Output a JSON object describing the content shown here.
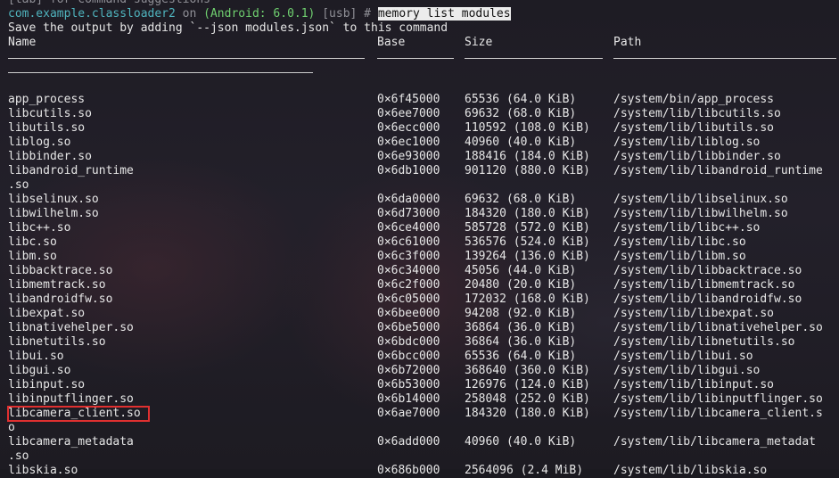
{
  "terminal": {
    "hint_line": "[tab] for command suggestions",
    "prompt": {
      "app": "com.example.classloader2",
      "on": " on ",
      "device": "(Android: 6.0.1)",
      "transport": " [usb] # ",
      "command": "memory list modules"
    },
    "info_line": "Save the output by adding `--json modules.json` to this command"
  },
  "table": {
    "headers": {
      "name": "Name",
      "base": "Base",
      "size": "Size",
      "path": "Path"
    },
    "rows": [
      {
        "name": "app_process",
        "base": "0x6f45000",
        "size": "65536 (64.0 KiB)",
        "path": "/system/bin/app_process"
      },
      {
        "name": "libcutils.so",
        "base": "0x6ee7000",
        "size": "69632 (68.0 KiB)",
        "path": "/system/lib/libcutils.so"
      },
      {
        "name": "libutils.so",
        "base": "0x6ecc000",
        "size": "110592 (108.0 KiB)",
        "path": "/system/lib/libutils.so"
      },
      {
        "name": "liblog.so",
        "base": "0x6ec1000",
        "size": "40960 (40.0 KiB)",
        "path": "/system/lib/liblog.so"
      },
      {
        "name": "libbinder.so",
        "base": "0x6e93000",
        "size": "188416 (184.0 KiB)",
        "path": "/system/lib/libbinder.so"
      },
      {
        "name": "libandroid_runtime.so",
        "name_wrap": ".so",
        "name_first": "libandroid_runtime.so",
        "base": "0x6db1000",
        "size": "901120 (880.0 KiB)",
        "path": "/system/lib/libandroid_runtime"
      },
      {
        "name": "libselinux.so",
        "base": "0x6da0000",
        "size": "69632 (68.0 KiB)",
        "path": "/system/lib/libselinux.so"
      },
      {
        "name": "libwilhelm.so",
        "base": "0x6d73000",
        "size": "184320 (180.0 KiB)",
        "path": "/system/lib/libwilhelm.so"
      },
      {
        "name": "libc++.so",
        "base": "0x6ce4000",
        "size": "585728 (572.0 KiB)",
        "path": "/system/lib/libc++.so"
      },
      {
        "name": "libc.so",
        "base": "0x6c61000",
        "size": "536576 (524.0 KiB)",
        "path": "/system/lib/libc.so"
      },
      {
        "name": "libm.so",
        "base": "0x6c3f000",
        "size": "139264 (136.0 KiB)",
        "path": "/system/lib/libm.so"
      },
      {
        "name": "libbacktrace.so",
        "base": "0x6c34000",
        "size": "45056 (44.0 KiB)",
        "path": "/system/lib/libbacktrace.so"
      },
      {
        "name": "libmemtrack.so",
        "base": "0x6c2f000",
        "size": "20480 (20.0 KiB)",
        "path": "/system/lib/libmemtrack.so"
      },
      {
        "name": "libandroidfw.so",
        "base": "0x6c05000",
        "size": "172032 (168.0 KiB)",
        "path": "/system/lib/libandroidfw.so"
      },
      {
        "name": "libexpat.so",
        "base": "0x6bee000",
        "size": "94208 (92.0 KiB)",
        "path": "/system/lib/libexpat.so"
      },
      {
        "name": "libnativehelper.so",
        "base": "0x6be5000",
        "size": "36864 (36.0 KiB)",
        "path": "/system/lib/libnativehelper.so"
      },
      {
        "name": "libnetutils.so",
        "base": "0x6bdc000",
        "size": "36864 (36.0 KiB)",
        "path": "/system/lib/libnetutils.so"
      },
      {
        "name": "libui.so",
        "base": "0x6bcc000",
        "size": "65536 (64.0 KiB)",
        "path": "/system/lib/libui.so"
      },
      {
        "name": "libgui.so",
        "base": "0x6b72000",
        "size": "368640 (360.0 KiB)",
        "path": "/system/lib/libgui.so"
      },
      {
        "name": "libinput.so",
        "base": "0x6b53000",
        "size": "126976 (124.0 KiB)",
        "path": "/system/lib/libinput.so"
      },
      {
        "name": "libinputflinger.so",
        "base": "0x6b14000",
        "size": "258048 (252.0 KiB)",
        "path": "/system/lib/libinputflinger.so"
      },
      {
        "name": "libcamera_client.so",
        "name_wrap": "o",
        "base": "0x6ae7000",
        "size": "184320 (180.0 KiB)",
        "path": "/system/lib/libcamera_client.s",
        "highlighted": true
      },
      {
        "name": "libcamera_metadata.so",
        "base": "0x6add000",
        "size": "40960 (40.0 KiB)",
        "path": "/system/lib/libcamera_metadat",
        "name_wrap": ".so",
        "name_first": "libcamera_metadata.so"
      },
      {
        "name": "libskia.so",
        "base": "0x686b000",
        "size": "2564096 (2.4 MiB)",
        "path": "/system/lib/libskia.so"
      }
    ]
  }
}
